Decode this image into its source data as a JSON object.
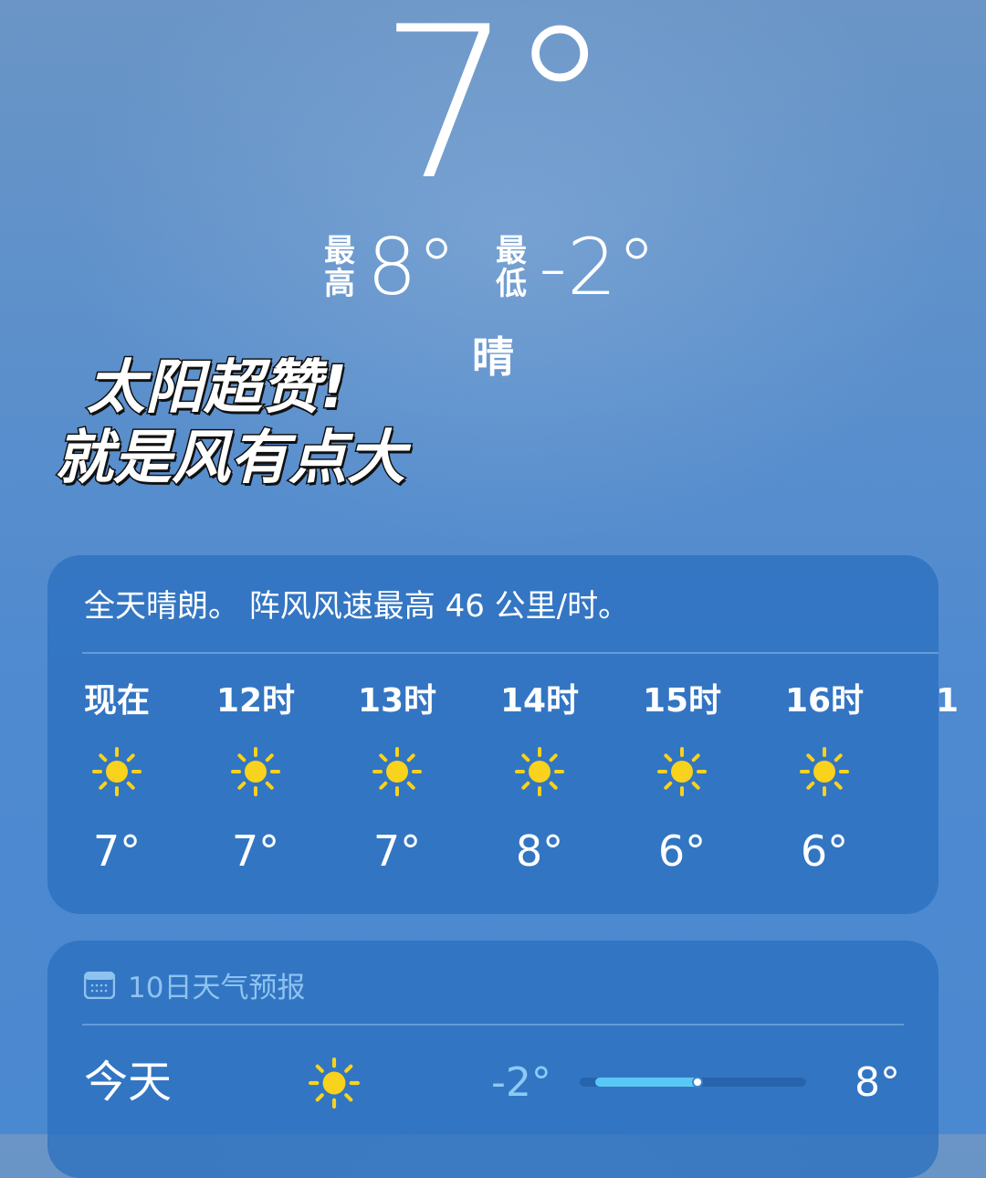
{
  "current": {
    "temperature": "7°",
    "high_label": "最\n高",
    "high": "8°",
    "low_label": "最\n低",
    "low": "-2°",
    "condition": "晴"
  },
  "caption": {
    "line1": "太阳超赞!",
    "line2": "就是风有点大"
  },
  "hourly": {
    "summary": "全天晴朗。 阵风风速最高 46 公里/时。",
    "items": [
      {
        "time": "现在",
        "icon": "sun-icon",
        "temp": "7°"
      },
      {
        "time": "12时",
        "icon": "sun-icon",
        "temp": "7°"
      },
      {
        "time": "13时",
        "icon": "sun-icon",
        "temp": "7°"
      },
      {
        "time": "14时",
        "icon": "sun-icon",
        "temp": "8°"
      },
      {
        "time": "15时",
        "icon": "sun-icon",
        "temp": "6°"
      },
      {
        "time": "16时",
        "icon": "sun-icon",
        "temp": "6°"
      },
      {
        "time": "1",
        "icon": "",
        "temp": ""
      }
    ]
  },
  "forecast": {
    "title": "10日天气预报",
    "icon": "calendar-icon",
    "days": [
      {
        "day": "今天",
        "icon": "sun-icon",
        "low": "-2°",
        "high": "8°",
        "current_fraction": 0.52
      }
    ]
  },
  "colors": {
    "sun": "#f8d21c",
    "low_temp": "#8ccaf5",
    "bar_fill": "#5ac8f5"
  }
}
